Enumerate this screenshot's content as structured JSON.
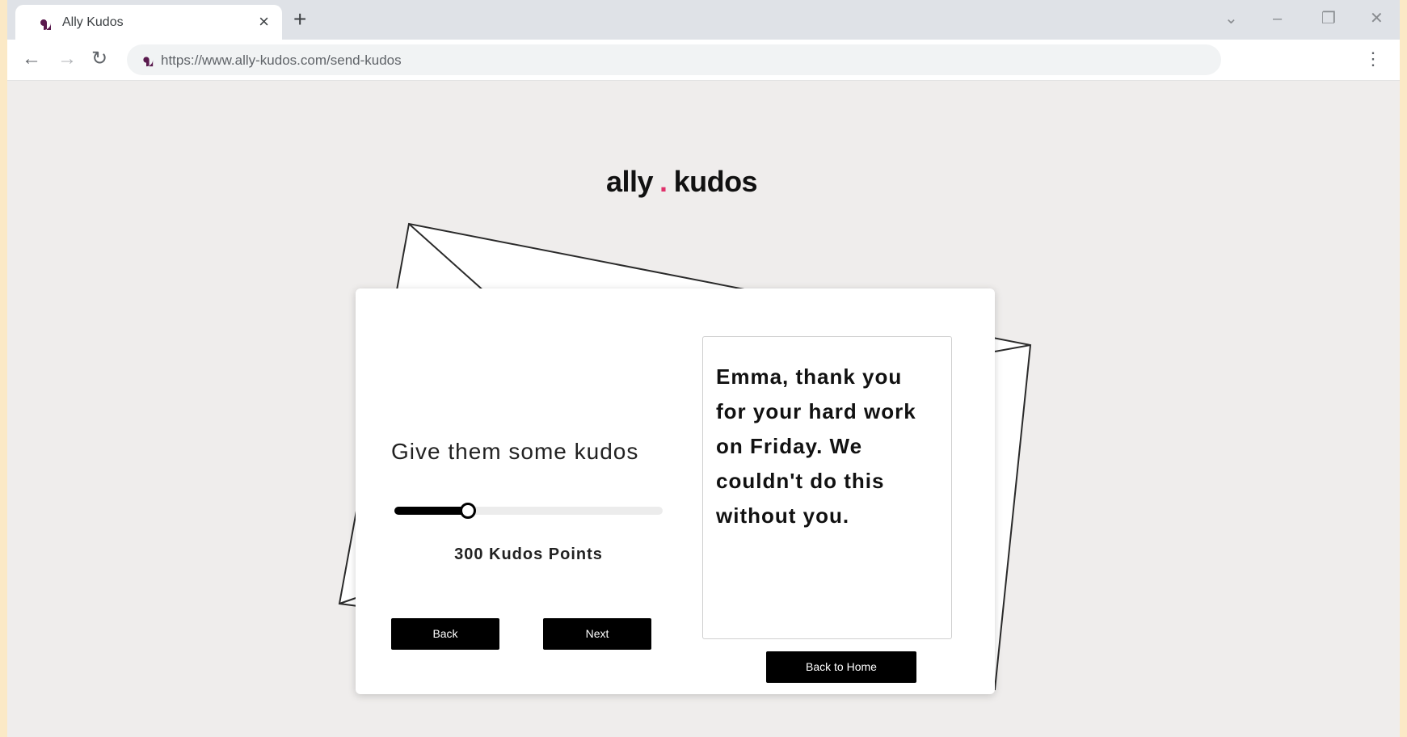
{
  "browser": {
    "tab_title": "Ally Kudos",
    "tab_close": "×",
    "new_tab": "+",
    "url": "https://www.ally-kudos.com/send-kudos",
    "controls": {
      "dropdown": "⌄",
      "minimize": "–",
      "restore": "❐",
      "close": "✕"
    },
    "nav": {
      "back": "←",
      "forward": "→",
      "reload": "↻",
      "menu": "⋮"
    }
  },
  "logo": {
    "left": "ally",
    "dot": ".",
    "right": "kudos"
  },
  "kudos": {
    "prompt": "Give them some kudos",
    "points_label": "300 Kudos Points",
    "slider_fraction": 0.27,
    "back_label": "Back",
    "next_label": "Next"
  },
  "message": {
    "text": "Emma, thank you for your hard work on Friday. We couldn't do this without you."
  },
  "home_button_label": "Back to Home",
  "colors": {
    "accent": "#e0316b",
    "favicon": "#5a1a4e",
    "button": "#000000"
  }
}
